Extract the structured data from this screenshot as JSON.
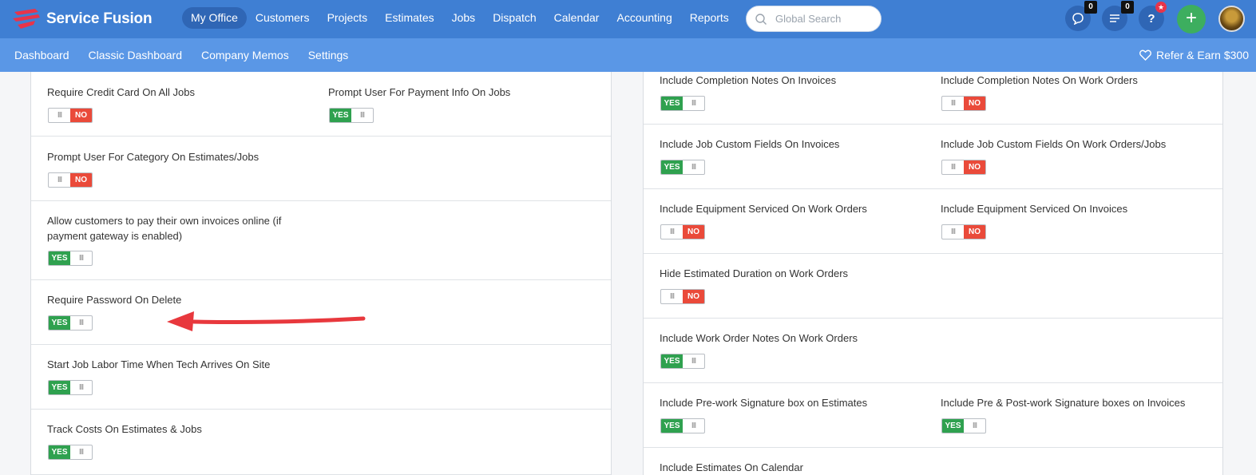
{
  "app": {
    "name": "Service Fusion"
  },
  "nav": {
    "items": [
      "My Office",
      "Customers",
      "Projects",
      "Estimates",
      "Jobs",
      "Dispatch",
      "Calendar",
      "Accounting",
      "Reports"
    ],
    "active": "My Office"
  },
  "search": {
    "placeholder": "Global Search"
  },
  "header_icons": {
    "chat_count": "0",
    "tasks_count": "0",
    "help_label": "?",
    "add_label": "+"
  },
  "subnav": {
    "items": [
      "Dashboard",
      "Classic Dashboard",
      "Company Memos",
      "Settings"
    ],
    "refer": "Refer & Earn $300"
  },
  "toggle_labels": {
    "yes": "YES",
    "no": "NO",
    "grip": "III"
  },
  "colors": {
    "topbar": "#3f7fd3",
    "subbar": "#5a97e6",
    "yes": "#2fa14f",
    "no": "#ea4a3a",
    "add": "#3dae5f",
    "arrow": "#e8383d"
  },
  "left_settings": [
    {
      "label": "Require Credit Card On All Jobs",
      "value": "NO"
    },
    {
      "label": "Prompt User For Payment Info On Jobs",
      "value": "YES"
    },
    {
      "label": "Prompt User For Category On Estimates/Jobs",
      "value": "NO"
    },
    {
      "label": "Allow customers to pay their own invoices online (if payment gateway is enabled)",
      "value": "YES"
    },
    {
      "label": "Require Password On Delete",
      "value": "YES"
    },
    {
      "label": "Start Job Labor Time When Tech Arrives On Site",
      "value": "YES"
    },
    {
      "label": "Track Costs On Estimates & Jobs",
      "value": "YES"
    }
  ],
  "right_settings": [
    {
      "label": "Include Completion Notes On Invoices",
      "value": "YES"
    },
    {
      "label": "Include Completion Notes On Work Orders",
      "value": "NO"
    },
    {
      "label": "Include Job Custom Fields On Invoices",
      "value": "YES"
    },
    {
      "label": "Include Job Custom Fields On Work Orders/Jobs",
      "value": "NO"
    },
    {
      "label": "Include Equipment Serviced On Work Orders",
      "value": "NO"
    },
    {
      "label": "Include Equipment Serviced On Invoices",
      "value": "NO"
    },
    {
      "label": "Hide Estimated Duration on Work Orders",
      "value": "NO"
    },
    {
      "label": "Include Work Order Notes On Work Orders",
      "value": "YES"
    },
    {
      "label": "Include Pre-work Signature box on Estimates",
      "value": "YES"
    },
    {
      "label": "Include Pre & Post-work Signature boxes on Invoices",
      "value": "YES"
    },
    {
      "label": "Include Estimates On Calendar",
      "value": ""
    }
  ]
}
